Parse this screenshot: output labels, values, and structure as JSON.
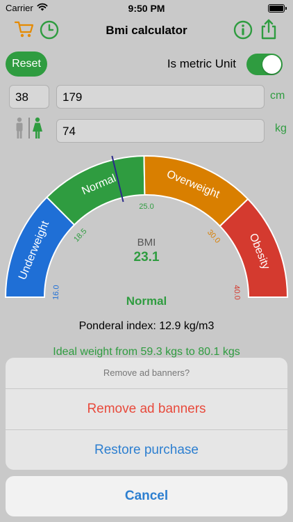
{
  "status_bar": {
    "carrier": "Carrier",
    "time": "9:50 PM"
  },
  "nav": {
    "title": "Bmi calculator",
    "icons": [
      "cart-icon",
      "history-clock-icon",
      "info-icon",
      "share-icon"
    ],
    "colors": {
      "orange": "#e58a00",
      "green": "#2f9c40"
    }
  },
  "controls": {
    "reset_label": "Reset",
    "metric_label": "Is metric Unit",
    "metric_on": true
  },
  "inputs": {
    "age": "38",
    "height": "179",
    "height_unit": "cm",
    "weight": "74",
    "weight_unit": "kg"
  },
  "gauge": {
    "segments": [
      {
        "label": "Underweight",
        "color": "#1f6fd6"
      },
      {
        "label": "Normal",
        "color": "#2f9c40"
      },
      {
        "label": "Overweight",
        "color": "#d97f00"
      },
      {
        "label": "Obesity",
        "color": "#d43a2f"
      }
    ],
    "ticks": [
      {
        "label": "16.0",
        "color": "#1f6fd6"
      },
      {
        "label": "18.5",
        "color": "#2f9c40"
      },
      {
        "label": "25.0",
        "color": "#2f9c40"
      },
      {
        "label": "30.0",
        "color": "#d97f00"
      },
      {
        "label": "40.0",
        "color": "#d43a2f"
      }
    ],
    "bmi_caption": "BMI",
    "bmi_value": "23.1",
    "category": "Normal"
  },
  "results": {
    "ponderal": "Ponderal index: 12.9 kg/m3",
    "ideal": "Ideal weight from 59.3 kgs to 80.1 kgs"
  },
  "action_sheet": {
    "title": "Remove ad banners?",
    "remove_label": "Remove ad banners",
    "restore_label": "Restore purchase",
    "cancel_label": "Cancel"
  }
}
